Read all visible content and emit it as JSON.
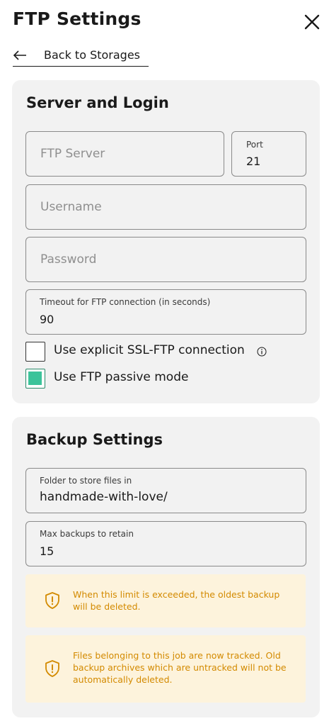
{
  "header": {
    "title": "FTP Settings",
    "close_label": "Close"
  },
  "back_link": {
    "label": "Back to Storages"
  },
  "server_section": {
    "title": "Server and Login",
    "ftp_server_placeholder": "FTP Server",
    "port": {
      "label": "Port",
      "value": "21"
    },
    "username_placeholder": "Username",
    "password_placeholder": "Password",
    "timeout": {
      "label": "Timeout for FTP connection (in seconds)",
      "value": "90"
    },
    "ssl_option": {
      "label": "Use explicit SSL-FTP connection",
      "checked": false
    },
    "passive_option": {
      "label": "Use FTP passive mode",
      "checked": true
    }
  },
  "backup_section": {
    "title": "Backup Settings",
    "folder": {
      "label": "Folder to store files in",
      "value": "handmade-with-love/"
    },
    "max_backups": {
      "label": "Max backups to retain",
      "value": "15"
    },
    "notices": [
      {
        "text": "When this limit is exceeded, the oldest backup will be deleted."
      },
      {
        "text": "Files belonging to this job are now tracked. Old backup archives which are untracked will not be automatically deleted."
      }
    ]
  },
  "colors": {
    "accent": "#3cc39a",
    "warning_bg": "#fdf3dc",
    "warning_text": "#d38a00",
    "card_bg": "#f2f2f2"
  },
  "icons": {
    "close": "close-icon",
    "back": "arrow-left-icon",
    "info": "info-icon",
    "warning": "shield-warning-icon"
  }
}
